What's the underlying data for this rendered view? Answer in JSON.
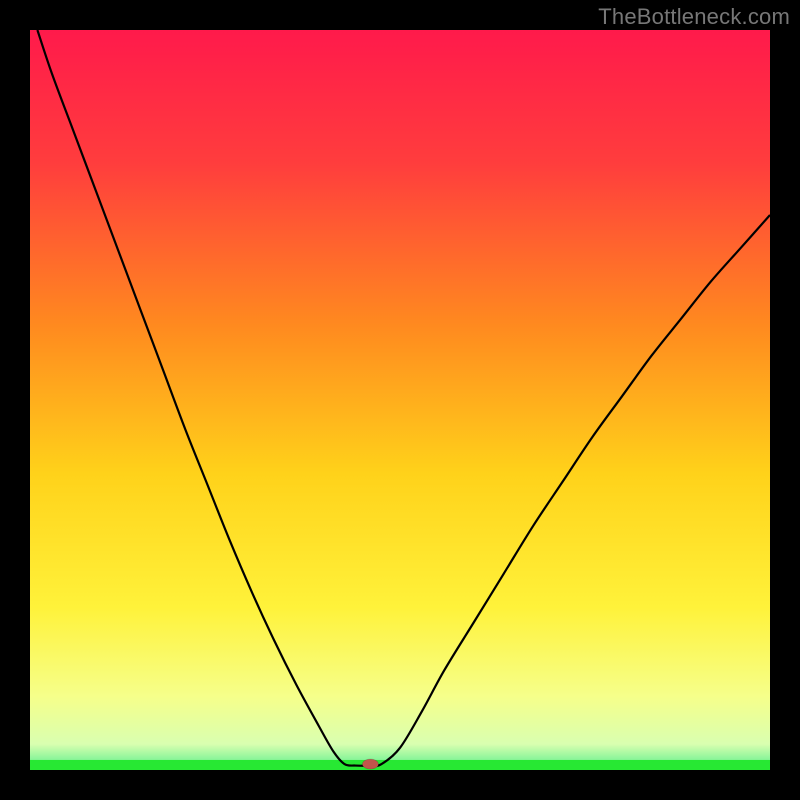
{
  "watermark": "TheBottleneck.com",
  "chart_data": {
    "type": "line",
    "title": "",
    "xlabel": "",
    "ylabel": "",
    "xlim": [
      0,
      100
    ],
    "ylim": [
      0,
      100
    ],
    "gradient": [
      {
        "offset": 0.0,
        "color": "#ff1a4b"
      },
      {
        "offset": 0.18,
        "color": "#ff3d3d"
      },
      {
        "offset": 0.4,
        "color": "#ff8a1f"
      },
      {
        "offset": 0.6,
        "color": "#ffd21a"
      },
      {
        "offset": 0.78,
        "color": "#fff23a"
      },
      {
        "offset": 0.9,
        "color": "#f6ff8a"
      },
      {
        "offset": 0.965,
        "color": "#d9ffb0"
      },
      {
        "offset": 0.985,
        "color": "#8cf59a"
      },
      {
        "offset": 1.0,
        "color": "#27e833"
      }
    ],
    "left_branch": {
      "x": [
        1,
        3,
        6,
        9,
        12,
        15,
        18,
        21,
        24,
        27,
        30,
        33,
        36,
        39,
        41,
        42.5
      ],
      "y": [
        100,
        94,
        86,
        78,
        70,
        62,
        54,
        46,
        38.5,
        31,
        24,
        17.5,
        11.5,
        6,
        2.5,
        0.8
      ]
    },
    "flat": {
      "x": [
        42.5,
        44,
        46,
        47.5
      ],
      "y": [
        0.8,
        0.6,
        0.6,
        0.8
      ]
    },
    "right_branch": {
      "x": [
        47.5,
        50,
        53,
        56,
        60,
        64,
        68,
        72,
        76,
        80,
        84,
        88,
        92,
        96,
        100
      ],
      "y": [
        0.8,
        3,
        8,
        13.5,
        20,
        26.5,
        33,
        39,
        45,
        50.5,
        56,
        61,
        66,
        70.5,
        75
      ]
    },
    "marker": {
      "x": 46,
      "y": 0.8,
      "color": "#c0564b",
      "rx": 8,
      "ry": 5
    }
  }
}
